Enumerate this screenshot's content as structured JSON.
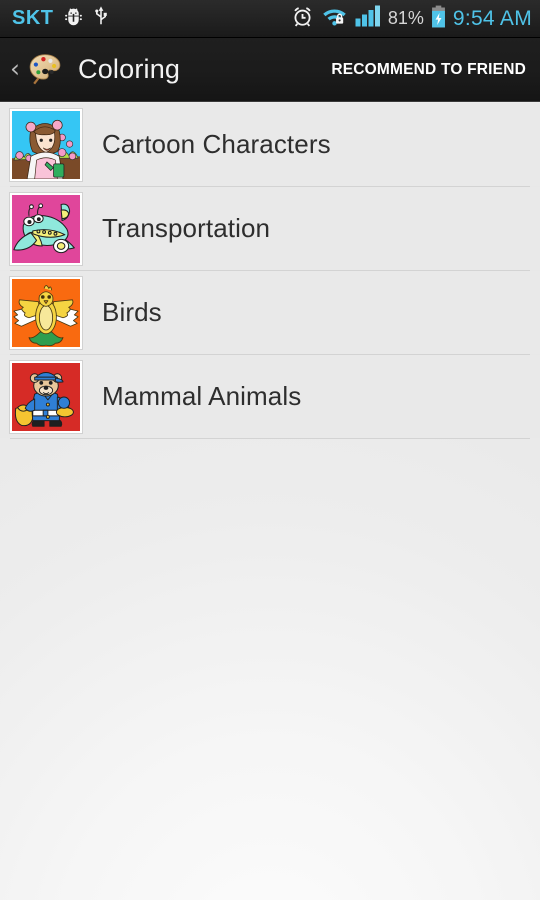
{
  "status_bar": {
    "carrier": "SKT",
    "icons": [
      "android-debug-bug-icon",
      "usb-icon",
      "alarm-clock-icon",
      "wifi-secure-icon",
      "cellular-signal-icon"
    ],
    "battery_percent": "81%",
    "battery_state": "charging",
    "time": "9:54 AM",
    "accent_color": "#4fc3e8",
    "background_color": "#222222"
  },
  "action_bar": {
    "back_label": "‹",
    "app_icon": "paint-palette-icon",
    "title": "Coloring",
    "action_label": "RECOMMEND TO FRIEND",
    "background_color": "#1b1b1b",
    "title_color": "#f2f2f2"
  },
  "list": {
    "items": [
      {
        "label": "Cartoon Characters",
        "thumbnail": "cartoon-girl-gardening-thumbnail",
        "thumb_bg": "#35c6f4"
      },
      {
        "label": "Transportation",
        "thumbnail": "cartoon-airplane-thumbnail",
        "thumb_bg": "#e0469b"
      },
      {
        "label": "Birds",
        "thumbnail": "yellow-bird-thumbnail",
        "thumb_bg": "#f96a10"
      },
      {
        "label": "Mammal Animals",
        "thumbnail": "bear-mailman-thumbnail",
        "thumb_bg": "#d62b26"
      }
    ],
    "row_background": "#e9e9e9",
    "divider_color": "#d3d3d3",
    "label_color": "#2e2e2e"
  }
}
